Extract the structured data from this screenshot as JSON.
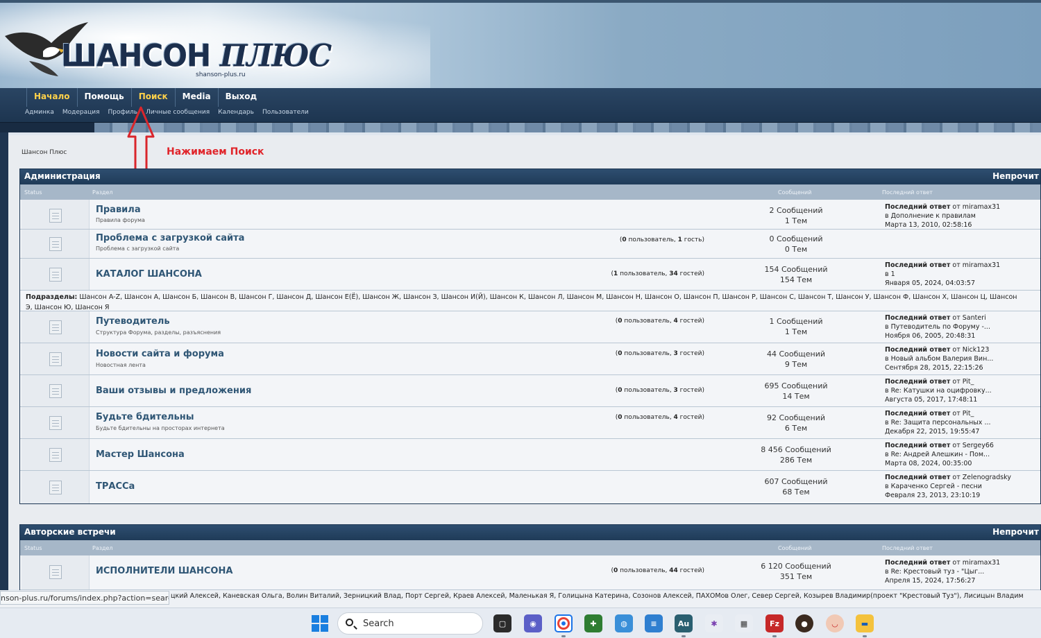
{
  "site": {
    "logo_main": "ШАНСОН",
    "logo_plus": "ПЛЮС",
    "logo_domain": "shanson-plus.ru"
  },
  "nav": {
    "main": [
      "Начало",
      "Помощь",
      "Поиск",
      "Media",
      "Выход"
    ],
    "sub": [
      "Админка",
      "Модерация",
      "Профиль",
      "Личные сообщения",
      "Календарь",
      "Пользователи"
    ]
  },
  "breadcrumb": "Шансон Плюс",
  "annotation": "Нажимаем Поиск",
  "columns": {
    "status": "Status",
    "section": "Раздел",
    "posts": "Сообщений",
    "last": "Последний ответ"
  },
  "last_label": "Последний ответ",
  "categories": [
    {
      "title": "Администрация",
      "unread": "Непрочит",
      "forums": [
        {
          "name": "Правила",
          "desc": "Правила форума",
          "viewers": "",
          "posts": "2 Сообщений",
          "topics": "1 Тем",
          "last_by": "от miramax31",
          "last_in": "в Дополнение к правилам",
          "last_date": "Марта 13, 2010, 02:58:16"
        },
        {
          "name": "Проблема с загрузкой сайта",
          "desc": "Проблема с загрузкой сайта",
          "viewers": "(0 пользователь, 1 гость)",
          "posts": "0 Сообщений",
          "topics": "0 Тем",
          "last_by": "",
          "last_in": "",
          "last_date": ""
        },
        {
          "name": "КАТАЛОГ ШАНСОНА",
          "desc": "",
          "viewers": "(1 пользователь, 34 гостей)",
          "posts": "154 Сообщений",
          "topics": "154 Тем",
          "last_by": "от miramax31",
          "last_in": "в 1",
          "last_date": "Января 05, 2024, 04:03:57"
        },
        {
          "name": "Путеводитель",
          "desc": "Структура Форума, разделы, разъяснения",
          "viewers": "(0 пользователь, 4 гостей)",
          "posts": "1 Сообщений",
          "topics": "1 Тем",
          "last_by": "от Santeri",
          "last_in": "в Путеводитель по Форуму -...",
          "last_date": "Ноября 06, 2005, 20:48:31"
        },
        {
          "name": "Новости сайта и форума",
          "desc": "Новостная лента",
          "viewers": "(0 пользователь, 3 гостей)",
          "posts": "44 Сообщений",
          "topics": "9 Тем",
          "last_by": "от Nick123",
          "last_in": "в Новый альбом Валерия Вин...",
          "last_date": "Сентября 28, 2015, 22:15:26"
        },
        {
          "name": "Ваши отзывы и предложения",
          "desc": "",
          "viewers": "(0 пользователь, 3 гостей)",
          "posts": "695 Сообщений",
          "topics": "14 Тем",
          "last_by": "от Pit_",
          "last_in": "в Re: Катушки на оцифровку...",
          "last_date": "Августа 05, 2017, 17:48:11"
        },
        {
          "name": "Будьте бдительны",
          "desc": "Будьте бдительны на просторах интернета",
          "viewers": "(0 пользователь, 4 гостей)",
          "posts": "92 Сообщений",
          "topics": "6 Тем",
          "last_by": "от Pit_",
          "last_in": "в Re: Защита персональных ...",
          "last_date": "Декабря 22, 2015, 19:55:47"
        },
        {
          "name": "Мастер Шансона",
          "desc": "",
          "viewers": "",
          "posts": "8 456 Сообщений",
          "topics": "286 Тем",
          "last_by": "от Sergey66",
          "last_in": "в Re: Андрей Алешкин - Пом...",
          "last_date": "Марта 08, 2024, 00:35:00"
        },
        {
          "name": "ТРАССа",
          "desc": "",
          "viewers": "",
          "posts": "607 Сообщений",
          "topics": "68 Тем",
          "last_by": "от Zelenogradsky",
          "last_in": "в Караченко Сергей - песни",
          "last_date": "Февраля 23, 2013, 23:10:19"
        }
      ],
      "subforums_label": "Подразделы:",
      "subforums_line1": "Шансон A-Z, Шансон А, Шансон Б, Шансон В, Шансон Г, Шансон Д, Шансон Е(Ё), Шансон Ж, Шансон З, Шансон И(Й), Шансон К, Шансон Л, Шансон М, Шансон Н, Шансон О, Шансон П, Шансон Р, Шансон С, Шансон Т, Шансон У, Шансон Ф, Шансон Х, Шансон Ц, Шансон",
      "subforums_line2": "Э, Шансон Ю, Шансон Я"
    },
    {
      "title": "Авторские встречи",
      "unread": "Непрочит",
      "forums": [
        {
          "name": "ИСПОЛНИТЕЛИ ШАНСОНА",
          "desc": "",
          "viewers": "(0 пользователь, 44 гостей)",
          "posts": "6 120 Сообщений",
          "topics": "351 Тем",
          "last_by": "от miramax31",
          "last_in": "в Re: Крестовый туз - \"Цыг...",
          "last_date": "Апреля 15, 2024, 17:56:27"
        }
      ]
    }
  ],
  "status_url": "nson-plus.ru/forums/index.php?action=search",
  "bottom_text": "цкий Алексей, Каневская Ольга, Волин Виталий, Зерницкий Влад, Порт Сергей, Краев Алексей, Маленькая Я, Голицына Катерина, Созонов Алексей, ПАХОМов Олег, Север Сергей, Козырев Владимир(проект \"Крестовый Туз\"), Лисицын Владим",
  "taskbar": {
    "search_label": "Search"
  }
}
